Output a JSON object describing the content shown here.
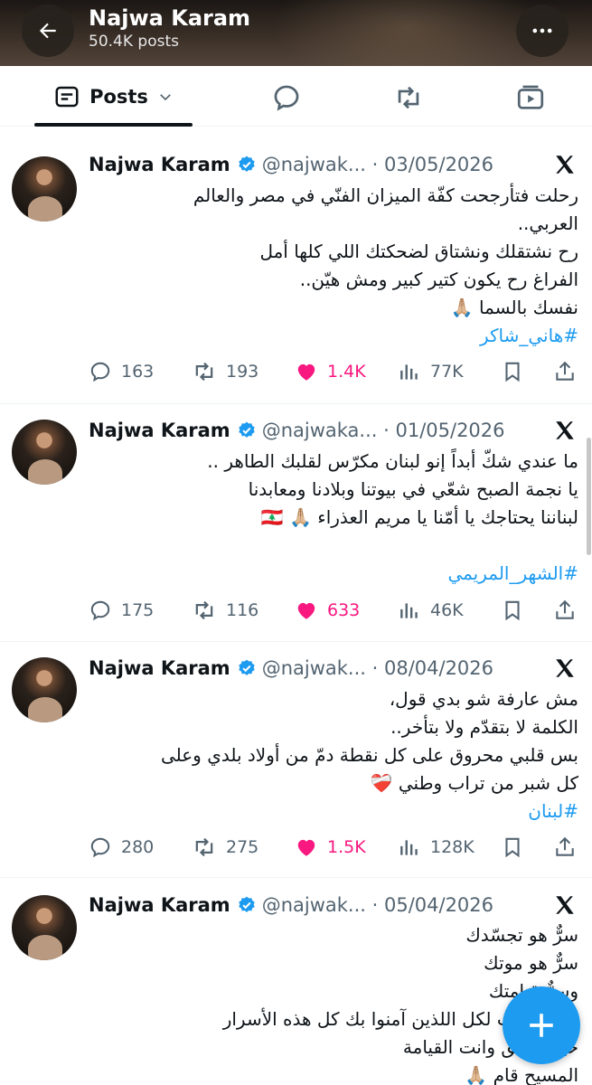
{
  "header": {
    "name": "Najwa Karam",
    "post_count": "50.4K posts"
  },
  "tabs": {
    "posts_label": "Posts"
  },
  "tweets": [
    {
      "name": "Najwa Karam",
      "handle": "@najwak...",
      "date": "03/05/2026",
      "lines": [
        "رحلت فتأرجحت كفّة الميزان الفنّي في مصر والعالم",
        "العربي..",
        "رح نشتقلك ونشتاق لضحكتك اللي كلها أمل",
        "الفراغ رح يكون كتير كبير ومش هيّن..",
        "نفسك بالسما 🙏🏼"
      ],
      "hashtag": "#هاني_شاكر",
      "replies": "163",
      "reposts": "193",
      "likes": "1.4K",
      "views": "77K"
    },
    {
      "name": "Najwa Karam",
      "handle": "@najwaka...",
      "date": "01/05/2026",
      "lines": [
        "ما عندي شكّ أبداً إنو لبنان مكرّس لقلبك الطاهر ..",
        "يا نجمة الصبح شعّي في بيوتنا وبلادنا ومعابدنا",
        "لبناننا يحتاجك يا أمّنا يا مريم العذراء 🙏🏼 🇱🇧"
      ],
      "hashtag": "#الشهر_المريمي",
      "replies": "175",
      "reposts": "116",
      "likes": "633",
      "views": "46K"
    },
    {
      "name": "Najwa Karam",
      "handle": "@najwak...",
      "date": "08/04/2026",
      "lines": [
        "مش عارفة شو بدي قول،",
        "الكلمة لا بتقدّم ولا بتأخر..",
        "بس قلبي محروق على كل نقطة دمّ من أولاد بلدي وعلى",
        "كل شبر من تراب وطني ❤️‍🩹"
      ],
      "hashtag": "#لبنان",
      "replies": "280",
      "reposts": "275",
      "likes": "1.5K",
      "views": "128K"
    },
    {
      "name": "Najwa Karam",
      "handle": "@najwak...",
      "date": "05/04/2026",
      "lines": [
        "سرٌّ هو تجسّدك",
        "سرٌّ هو موتك",
        "وسرٌّ قيامتك",
        "لقد كشفت لكل اللذين  آمنوا بك كل  هذه الأسرار",
        "حيث الحق وانت القيامة",
        "المسيح قام 🙏🏼"
      ]
    }
  ],
  "colors": {
    "accent": "#1d9bf0",
    "like": "#f91880",
    "muted": "#536471",
    "text": "#0f1419"
  },
  "icons": [
    "back-arrow-icon",
    "more-icon",
    "posts-icon",
    "chevron-down-icon",
    "replies-icon",
    "reposts-icon",
    "media-icon",
    "verified-icon",
    "x-logo-icon",
    "reply-icon",
    "repost-icon",
    "heart-icon",
    "views-icon",
    "bookmark-icon",
    "share-icon",
    "plus-icon"
  ]
}
